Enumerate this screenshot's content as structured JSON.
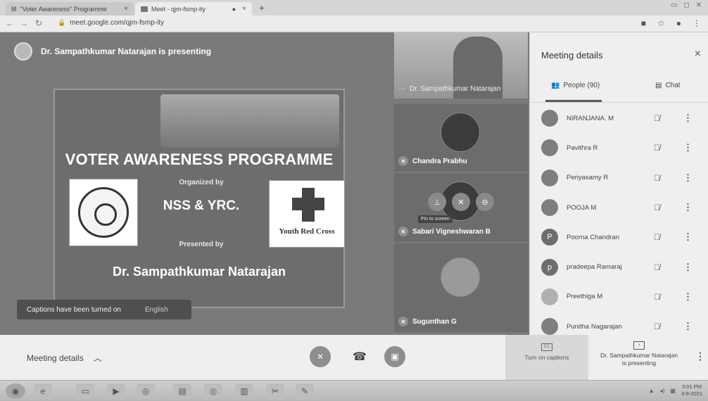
{
  "browser": {
    "tabs": [
      {
        "icon": "gmail-icon",
        "title": "\"Voter Awareness\" Programme",
        "close": "×"
      },
      {
        "icon": "meet-icon",
        "title": "Meet - qjm-fsmp-ity",
        "close": "×"
      }
    ],
    "new_tab": "+",
    "address": "meet.google.com/qjm-fsmp-ity"
  },
  "stage": {
    "presenter_text": "Dr. Sampathkumar Natarajan is presenting",
    "slide": {
      "title": "VOTER AWARENESS PROGRAMME",
      "organized_by": "Organized by",
      "org_name": "NSS & YRC.",
      "presented_by": "Presented by",
      "presenter": "Dr. Sampathkumar Natarajan",
      "yrc_logo_text": "Youth Red Cross"
    },
    "captions_toast": {
      "text": "Captions have been turned on",
      "language": "English"
    }
  },
  "tiles": [
    {
      "name": "Dr. Sampathkumar Natarajan"
    },
    {
      "name": "Chandra Prabhu"
    },
    {
      "name": "Sabari Vigneshwaran B"
    },
    {
      "name": "Sugunthan G"
    }
  ],
  "tile_tooltip": "Pin to screen",
  "panel": {
    "title": "Meeting details",
    "close": "×",
    "tab_people": "People (90)",
    "tab_chat": "Chat",
    "people": [
      {
        "name": "NIRANJANA. M",
        "initial": ""
      },
      {
        "name": "Pavithra R",
        "initial": ""
      },
      {
        "name": "Periyasamy R",
        "initial": ""
      },
      {
        "name": "POOJA M",
        "initial": ""
      },
      {
        "name": "Poorna Chandran",
        "initial": "P"
      },
      {
        "name": "pradeepa Ramaraj",
        "initial": "p"
      },
      {
        "name": "Preethiga M",
        "initial": ""
      },
      {
        "name": "Punitha Nagarajan",
        "initial": ""
      }
    ]
  },
  "bottom": {
    "meeting_details": "Meeting details",
    "captions": "Turn on captions",
    "present_line1": "Dr. Sampathkumar Natarajan",
    "present_line2": "is presenting"
  },
  "taskbar": {
    "time": "3:01 PM",
    "date": "3-9-2021"
  }
}
